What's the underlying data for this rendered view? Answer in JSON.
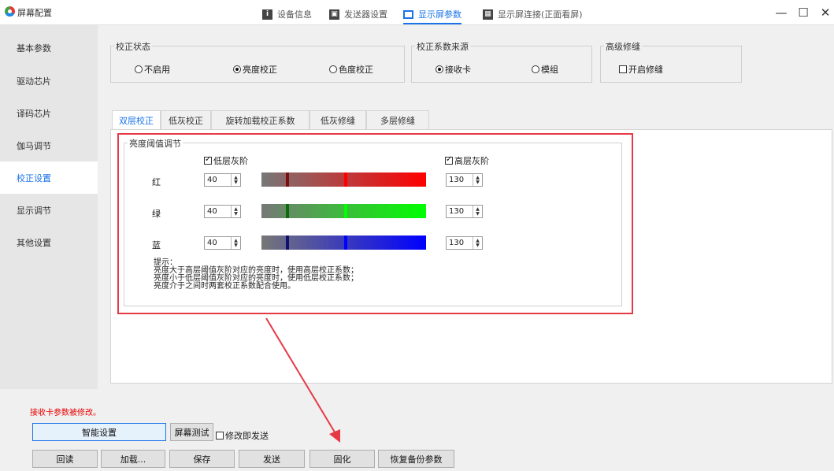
{
  "window": {
    "title": "屏幕配置"
  },
  "top_tabs": [
    {
      "icon": "info-icon",
      "label": "设备信息"
    },
    {
      "icon": "sender-icon",
      "label": "发送器设置"
    },
    {
      "icon": "display-settings-icon",
      "label": "显示屏参数",
      "active": true
    },
    {
      "icon": "screen-connect-icon",
      "label": "显示屏连接(正面看屏)"
    }
  ],
  "sidebar": {
    "items": [
      {
        "label": "基本参数"
      },
      {
        "label": "驱动芯片"
      },
      {
        "label": "译码芯片"
      },
      {
        "label": "伽马调节"
      },
      {
        "label": "校正设置",
        "active": true
      },
      {
        "label": "显示调节"
      },
      {
        "label": "其他设置"
      }
    ]
  },
  "correction_status": {
    "title": "校正状态",
    "options": [
      "不启用",
      "亮度校正",
      "色度校正"
    ],
    "selected": "亮度校正"
  },
  "correction_source": {
    "title": "校正系数来源",
    "options": [
      "接收卡",
      "模组"
    ],
    "selected": "接收卡"
  },
  "advanced_seam": {
    "title": "高级修缝",
    "checkbox_label": "开启修缝",
    "checked": false
  },
  "sub_tabs": [
    {
      "label": "双层校正",
      "active": true
    },
    {
      "label": "低灰校正"
    },
    {
      "label": "旋转加载校正系数"
    },
    {
      "label": "低灰修缝"
    },
    {
      "label": "多层修缝"
    }
  ],
  "threshold": {
    "title": "亮度阈值调节",
    "low_label": "低层灰阶",
    "low_checked": true,
    "high_label": "高层灰阶",
    "high_checked": true,
    "rows": [
      {
        "label": "红",
        "low": "40",
        "high": "130",
        "low_fraction": 0.157,
        "high_fraction": 0.51,
        "color": "#ff0000",
        "dark": "#7a1010"
      },
      {
        "label": "绿",
        "low": "40",
        "high": "130",
        "low_fraction": 0.157,
        "high_fraction": 0.51,
        "color": "#00ff00",
        "dark": "#0d6a0d"
      },
      {
        "label": "蓝",
        "low": "40",
        "high": "130",
        "low_fraction": 0.157,
        "high_fraction": 0.51,
        "color": "#0000ff",
        "dark": "#101070"
      }
    ],
    "hint_lines": [
      "提示：",
      "亮度大于高层阈值灰阶对应的亮度时，使用高层校正系数；",
      "亮度小于低层阈值灰阶对应的亮度时，使用低层校正系数；",
      "亮度介于之间时两套校正系数配合使用。"
    ]
  },
  "bottom": {
    "message": "接收卡参数被修改。",
    "smart_setup": "智能设置",
    "screen_test": "屏幕测试",
    "send_on_modify": "修改即发送",
    "send_on_modify_checked": false,
    "buttons": [
      "回读",
      "加载...",
      "保存",
      "发送",
      "固化",
      "恢复备份参数"
    ]
  },
  "colors": {
    "accent": "#1a73e8",
    "highlight": "#e63946",
    "warning": "#e60000"
  }
}
